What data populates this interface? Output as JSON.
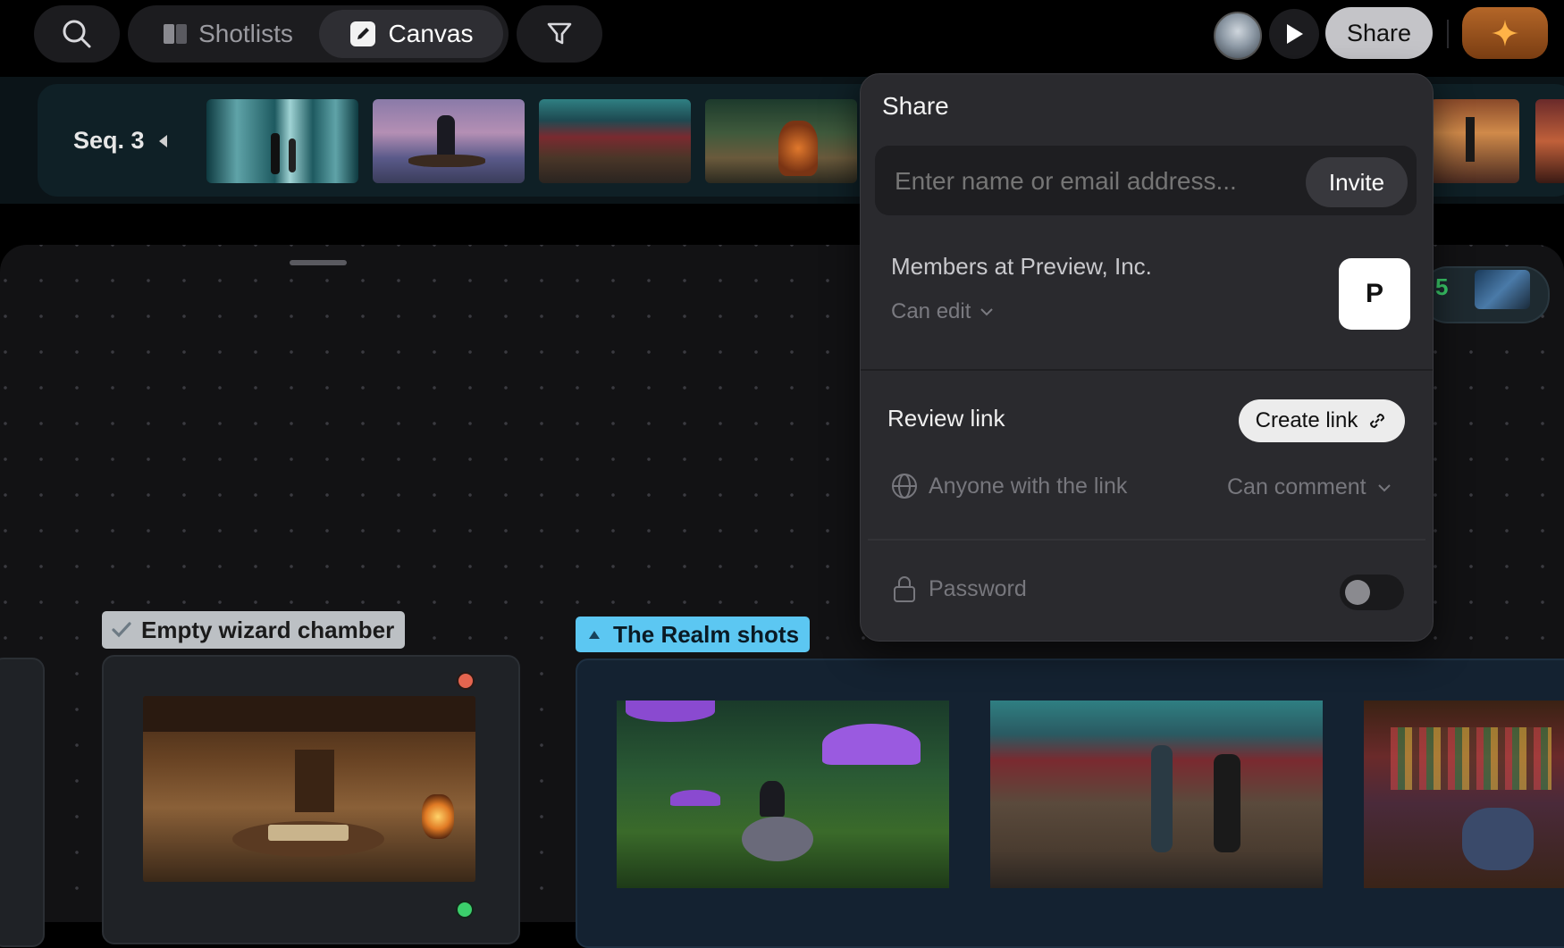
{
  "toolbar": {
    "tab_shotlists": "Shotlists",
    "tab_canvas": "Canvas",
    "share_label": "Share"
  },
  "sequence": {
    "label": "Seq. 3"
  },
  "share_panel": {
    "title": "Share",
    "invite_placeholder": "Enter name or email address...",
    "invite_button": "Invite",
    "members_label": "Members at Preview, Inc.",
    "members_permission": "Can edit",
    "org_avatar_letter": "P",
    "review_link_label": "Review link",
    "create_link_button": "Create link",
    "link_access": "Anyone with the link",
    "link_permission": "Can comment",
    "password_label": "Password"
  },
  "canvas": {
    "badge_count": "5",
    "group_wizard_label": "Empty wizard chamber",
    "group_realm_label": "The Realm shots"
  },
  "colors": {
    "accent_blue": "#5cc7f2",
    "status_red": "#e5654f",
    "status_green": "#3bcf6b",
    "badge_green": "#3bcf6b",
    "ai_button": "#a0561b"
  }
}
